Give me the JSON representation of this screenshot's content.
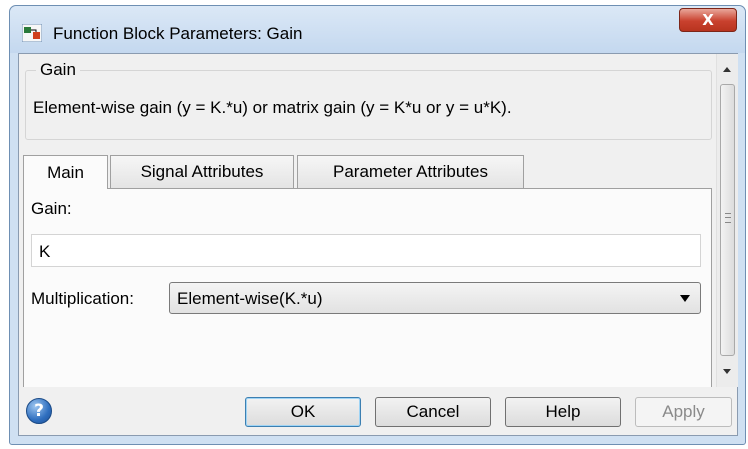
{
  "window": {
    "title": "Function Block Parameters: Gain",
    "close_label": "X"
  },
  "group": {
    "title": "Gain",
    "description": "Element-wise gain (y = K.*u) or matrix gain (y = K*u or y = u*K)."
  },
  "tabs": [
    {
      "label": "Main",
      "active": true
    },
    {
      "label": "Signal Attributes",
      "active": false
    },
    {
      "label": "Parameter Attributes",
      "active": false
    }
  ],
  "main": {
    "gain_label": "Gain:",
    "gain_value": "K",
    "multiplication_label": "Multiplication:",
    "multiplication_value": "Element-wise(K.*u)"
  },
  "buttons": {
    "help_icon_glyph": "?",
    "ok": "OK",
    "cancel": "Cancel",
    "help": "Help",
    "apply": "Apply"
  },
  "colors": {
    "window_frame": "#cfe0f2",
    "close_button": "#c9412e",
    "default_button_border": "#3c7fb1"
  }
}
